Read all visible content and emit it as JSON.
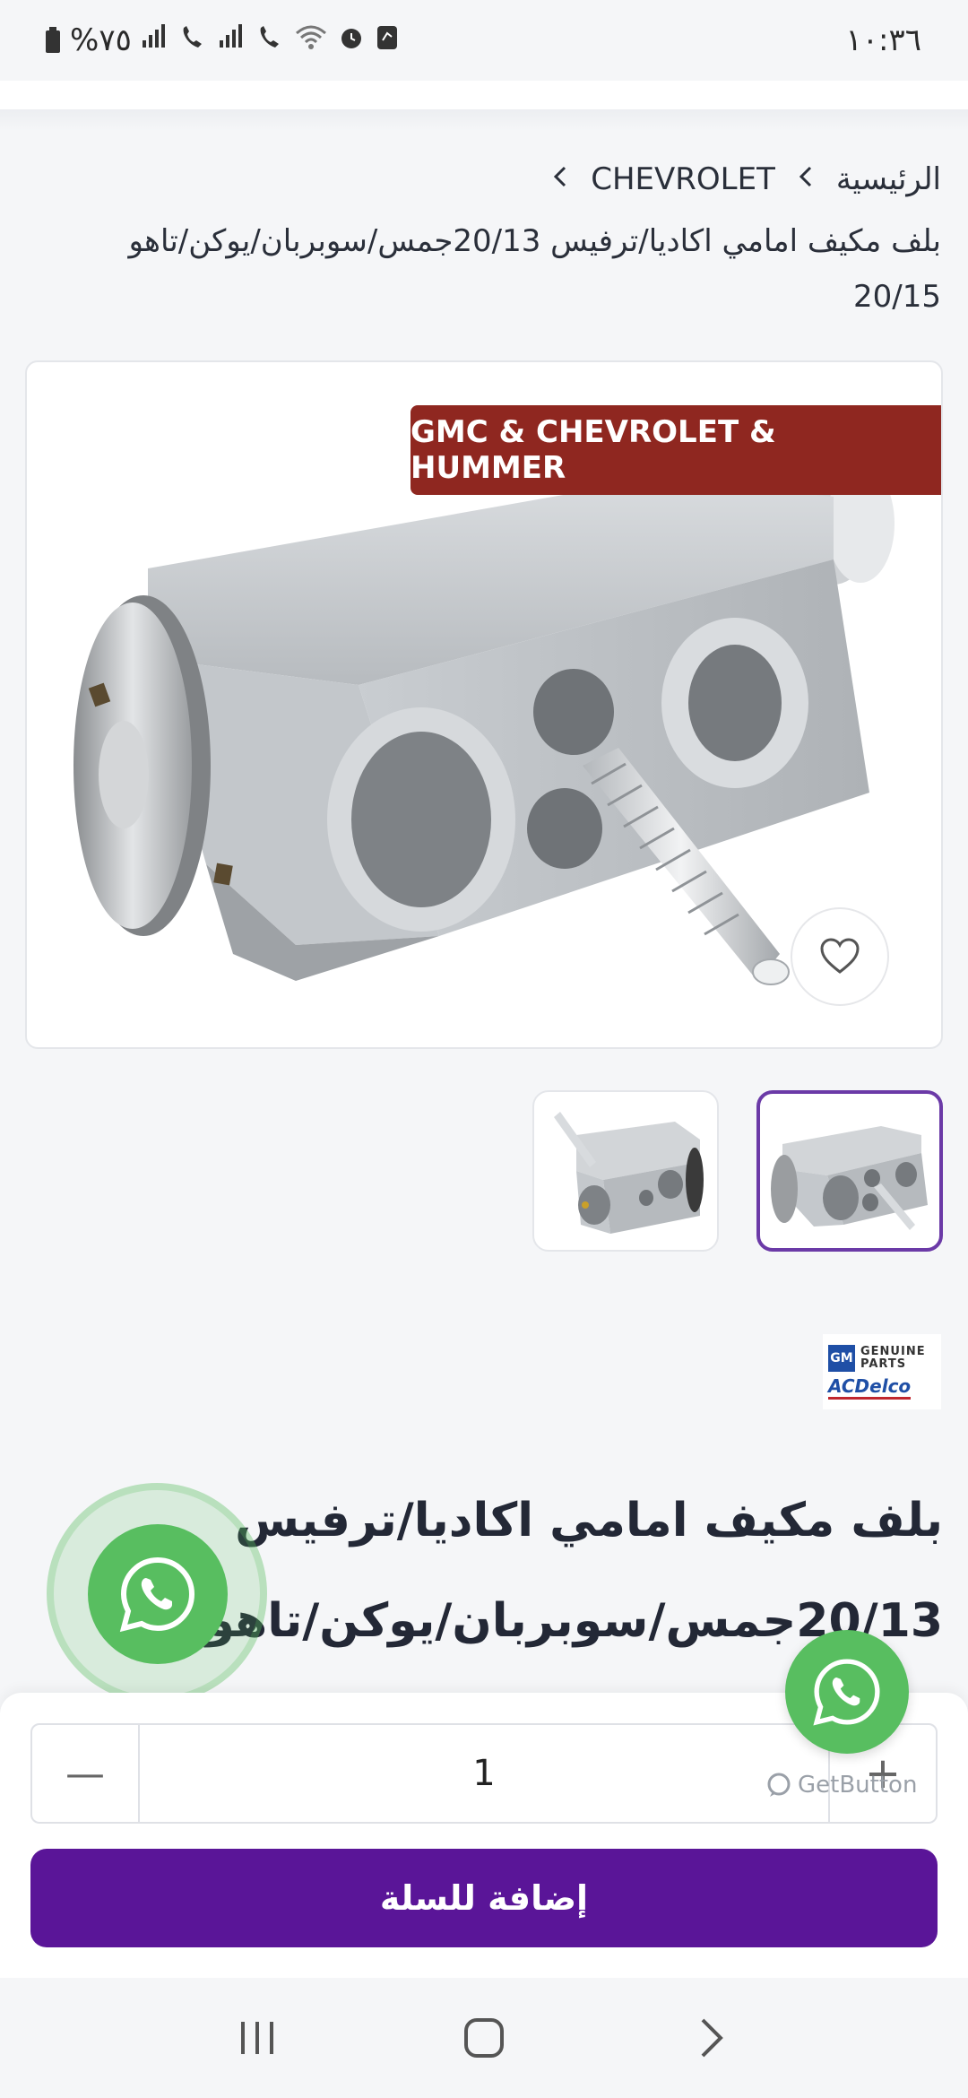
{
  "status_bar": {
    "time": "١٠:٣٦",
    "battery": "%٧٥"
  },
  "breadcrumb": {
    "home": "الرئيسية",
    "category": "CHEVROLET",
    "current": "بلف مكيف امامي اكاديا/ترفيس 20/13جمس/سوبربان/يوكن/تاهو 20/15"
  },
  "product": {
    "ribbon": "GMC & CHEVROLET & HUMMER",
    "brand_logo": {
      "gm": "GM",
      "line1": "GENUINE",
      "line2": "PARTS",
      "acdelco": "ACDelco"
    },
    "title": "بلف مكيف امامي اكاديا/ترفيس 20/13جمس/سوبربان/يوكن/تاهو 20/15"
  },
  "cart": {
    "quantity": "1",
    "minus": "—",
    "plus": "+",
    "add_to_cart": "إضافة للسلة"
  },
  "widget": {
    "getbutton": "GetButton"
  },
  "colors": {
    "primary": "#5a1598",
    "ribbon": "#8f2720",
    "whatsapp": "#58be60"
  }
}
